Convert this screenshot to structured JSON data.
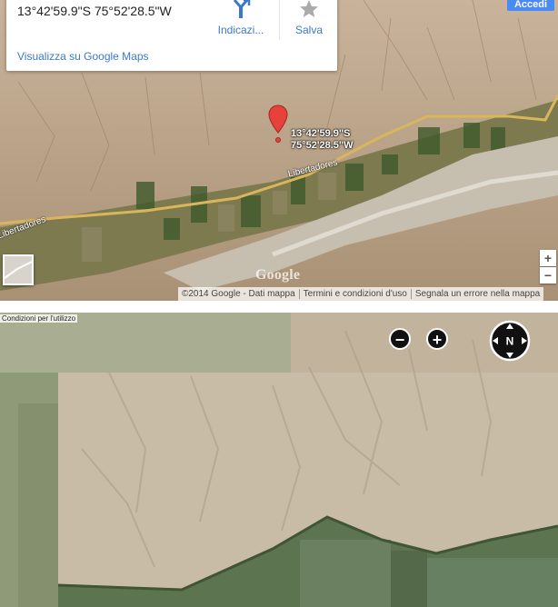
{
  "info_card": {
    "coordinates": "13°42'59.9\"S 75°52'28.5\"W",
    "directions_label": "Indicazi...",
    "save_label": "Salva",
    "view_on_maps_link": "Visualizza su Google Maps",
    "directions_icon": "directions-icon",
    "save_icon": "star-icon"
  },
  "header": {
    "signin_label": "Accedi"
  },
  "marker": {
    "label": "13°42'59.9\"S\n75°52'28.5\"W",
    "icon": "map-pin-icon"
  },
  "roads": [
    {
      "label": "Libertadores"
    },
    {
      "label": "Libertadores"
    }
  ],
  "zoom_controls": {
    "zoom_in": "+",
    "zoom_out": "−"
  },
  "logo": "Google",
  "attribution": {
    "copyright": "©2014 Google - Dati mappa",
    "terms": "Termini e condizioni d'uso",
    "report_error": "Segnala un errore nella mappa"
  },
  "bottom_viewer": {
    "terms_label": "Condizioni per l'utilizzo",
    "zoom_out": "−",
    "zoom_in": "+",
    "compass_label": "N",
    "compass_icon": "compass-icon"
  },
  "colors": {
    "link": "#3b78c9",
    "accent": "#4a8af4",
    "pin": "#e8403a",
    "road": "#d9b65c"
  }
}
